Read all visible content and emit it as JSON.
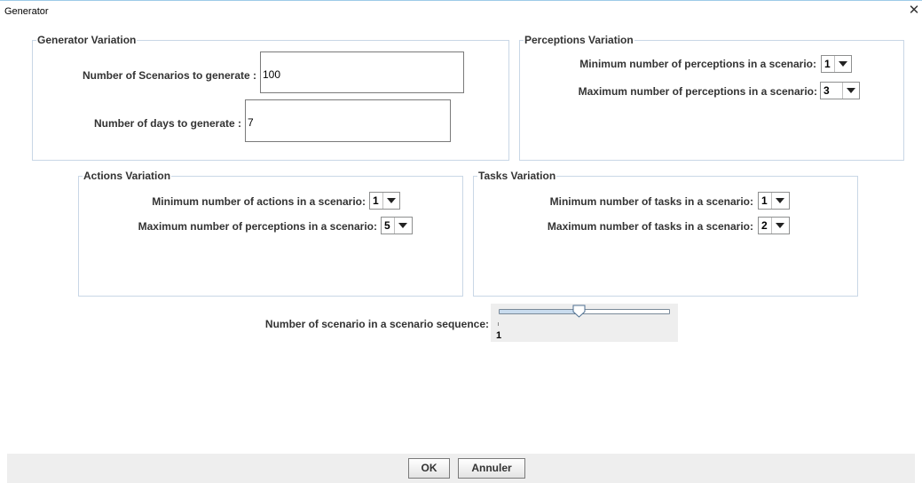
{
  "window": {
    "title": "Generator",
    "close_glyph": "✕"
  },
  "generator_variation": {
    "legend": "Generator Variation",
    "scenarios_label": "Number of Scenarios to generate :",
    "scenarios_value": "100",
    "days_label": "Number of days to generate :",
    "days_value": "7"
  },
  "perceptions_variation": {
    "legend": "Perceptions Variation",
    "min_label": "Minimum number of perceptions in a scenario:",
    "min_value": "1",
    "max_label": "Maximum number of perceptions in a scenario:",
    "max_value": "3"
  },
  "actions_variation": {
    "legend": "Actions Variation",
    "min_label": "Minimum number of actions in a scenario:",
    "min_value": "1",
    "max_label": "Maximum number of perceptions in a scenario:",
    "max_value": "5"
  },
  "tasks_variation": {
    "legend": "Tasks Variation",
    "min_label": "Minimum number of tasks in a scenario:",
    "min_value": "1",
    "max_label": "Maximum number of tasks in a scenario:",
    "max_value": "2"
  },
  "sequence": {
    "label": "Number of scenario in a scenario sequence:",
    "tick_label": "1",
    "slider_fraction": 0.47
  },
  "buttons": {
    "ok": "OK",
    "cancel": "Annuler"
  },
  "colors": {
    "border": "#c9d7e6",
    "panel_bg": "#eeeeee",
    "accent": "#9ecbe8"
  }
}
